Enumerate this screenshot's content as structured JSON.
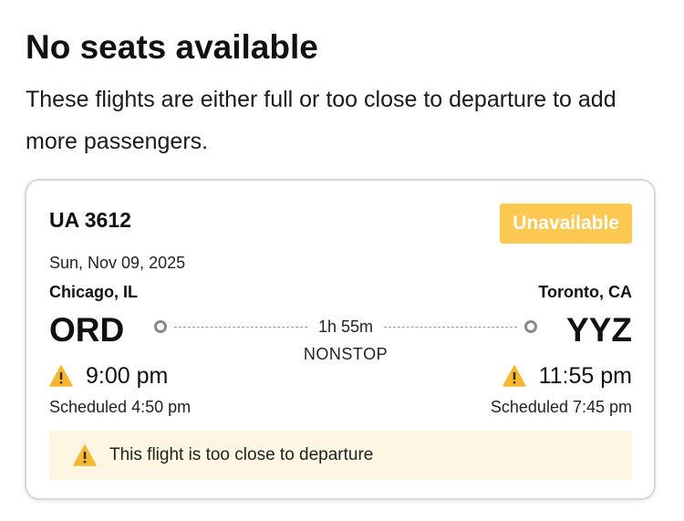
{
  "header": {
    "title": "No seats available",
    "subtitle": "These flights are either full or too close to departure to add more passengers."
  },
  "flight": {
    "number": "UA 3612",
    "status_badge": "Unavailable",
    "date": "Sun, Nov 09, 2025",
    "origin": {
      "city": "Chicago, IL",
      "code": "ORD",
      "time": "9:00 pm",
      "scheduled": "Scheduled 4:50 pm"
    },
    "destination": {
      "city": "Toronto, CA",
      "code": "YYZ",
      "time": "11:55 pm",
      "scheduled": "Scheduled 7:45 pm"
    },
    "duration": "1h 55m",
    "stops": "NONSTOP",
    "notice": "This flight is too close to departure"
  },
  "colors": {
    "badge": "#fcc850",
    "warning_icon": "#f7b731",
    "notice_bg": "#fdf6e3",
    "route_circle": "#8a8a8a"
  },
  "icons": {
    "warning": "warning-triangle-icon",
    "origin_marker": "circle-outline-icon",
    "destination_marker": "circle-outline-icon"
  }
}
